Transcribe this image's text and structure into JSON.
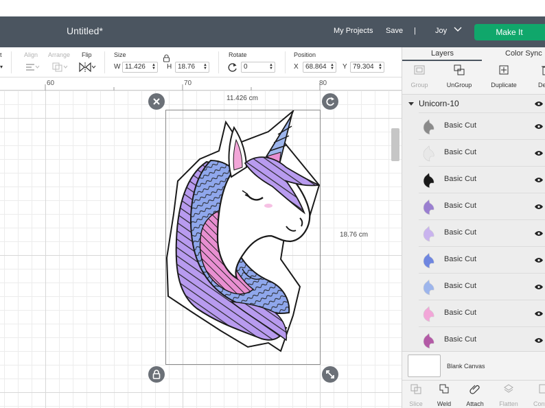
{
  "header": {
    "title": "Untitled*",
    "my_projects": "My Projects",
    "save": "Save",
    "separator": "|",
    "user": "Joy",
    "make_it": "Make It"
  },
  "toolbar": {
    "edit_fragment": "t",
    "align": "Align",
    "arrange": "Arrange",
    "flip": "Flip",
    "size": "Size",
    "w_label": "W",
    "w_value": "11.426",
    "h_label": "H",
    "h_value": "18.76",
    "rotate": "Rotate",
    "rotate_value": "0",
    "position": "Position",
    "x_label": "X",
    "x_value": "68.864",
    "y_label": "Y",
    "y_value": "79.304"
  },
  "ruler": {
    "marks": [
      "60",
      "70",
      "80"
    ]
  },
  "canvas": {
    "width_label": "11.426 cm",
    "height_label": "18.76 cm"
  },
  "panel": {
    "tabs": [
      "Layers",
      "Color Sync"
    ],
    "actions": [
      {
        "label": "Group",
        "icon": "group-icon",
        "enabled": false
      },
      {
        "label": "UnGroup",
        "icon": "ungroup-icon",
        "enabled": true
      },
      {
        "label": "Duplicate",
        "icon": "duplicate-icon",
        "enabled": true
      },
      {
        "label": "Dele",
        "icon": "delete-icon",
        "enabled": true
      }
    ],
    "group_name": "Unicorn-10",
    "layers": [
      {
        "name": "Basic Cut",
        "color": "#8a8a8a"
      },
      {
        "name": "Basic Cut",
        "color": "#e8e8e8"
      },
      {
        "name": "Basic Cut",
        "color": "#1a1a1a"
      },
      {
        "name": "Basic Cut",
        "color": "#9a7fd0"
      },
      {
        "name": "Basic Cut",
        "color": "#c9b3ee"
      },
      {
        "name": "Basic Cut",
        "color": "#6f86e0"
      },
      {
        "name": "Basic Cut",
        "color": "#9db5ec"
      },
      {
        "name": "Basic Cut",
        "color": "#f2a6d8"
      },
      {
        "name": "Basic Cut",
        "color": "#b35aa6"
      }
    ],
    "blank_canvas": "Blank Canvas",
    "bottom_actions": [
      {
        "label": "Slice",
        "enabled": false
      },
      {
        "label": "Weld",
        "enabled": true
      },
      {
        "label": "Attach",
        "enabled": true
      },
      {
        "label": "Flatten",
        "enabled": false
      },
      {
        "label": "Cont",
        "enabled": false
      }
    ]
  },
  "colors": {
    "header_bg": "#4b5560",
    "make_it": "#10a76b",
    "mane_purple": "#b89bef",
    "mane_blue": "#8fa7ec",
    "mane_pink": "#e88fd1",
    "horn_pink": "#d46fc0"
  }
}
